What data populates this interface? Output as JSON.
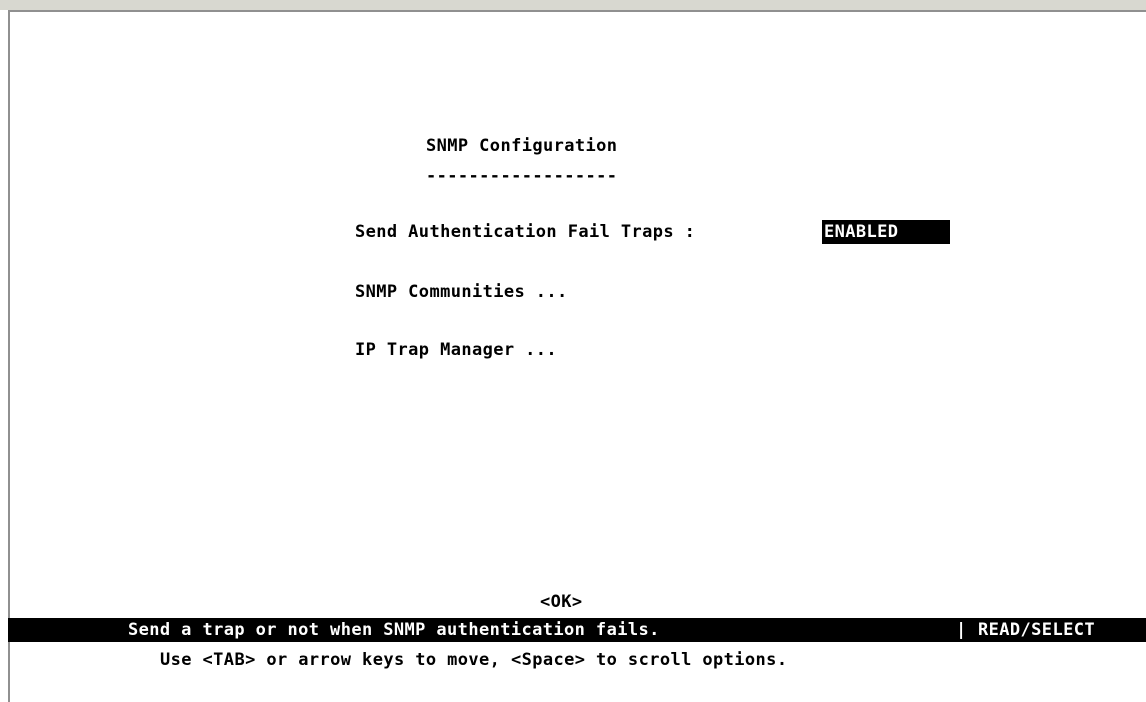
{
  "screen": {
    "title": "SNMP Configuration",
    "title_underline": "------------------"
  },
  "fields": {
    "auth_fail_traps": {
      "label": "Send Authentication Fail Traps :",
      "value": "ENABLED"
    },
    "snmp_communities": {
      "label": "SNMP Communities ..."
    },
    "ip_trap_manager": {
      "label": "IP Trap Manager ..."
    }
  },
  "buttons": {
    "ok_label": "<OK>"
  },
  "status_bar": {
    "message": "Send a trap or not when SNMP authentication fails.",
    "separator": "|",
    "mode": "READ/SELECT"
  },
  "help_text": "Use <TAB> or arrow keys to move, <Space> to scroll options.",
  "colors": {
    "background": "#ffffff",
    "foreground": "#000000",
    "highlight_bg": "#000000",
    "highlight_fg": "#ffffff"
  }
}
